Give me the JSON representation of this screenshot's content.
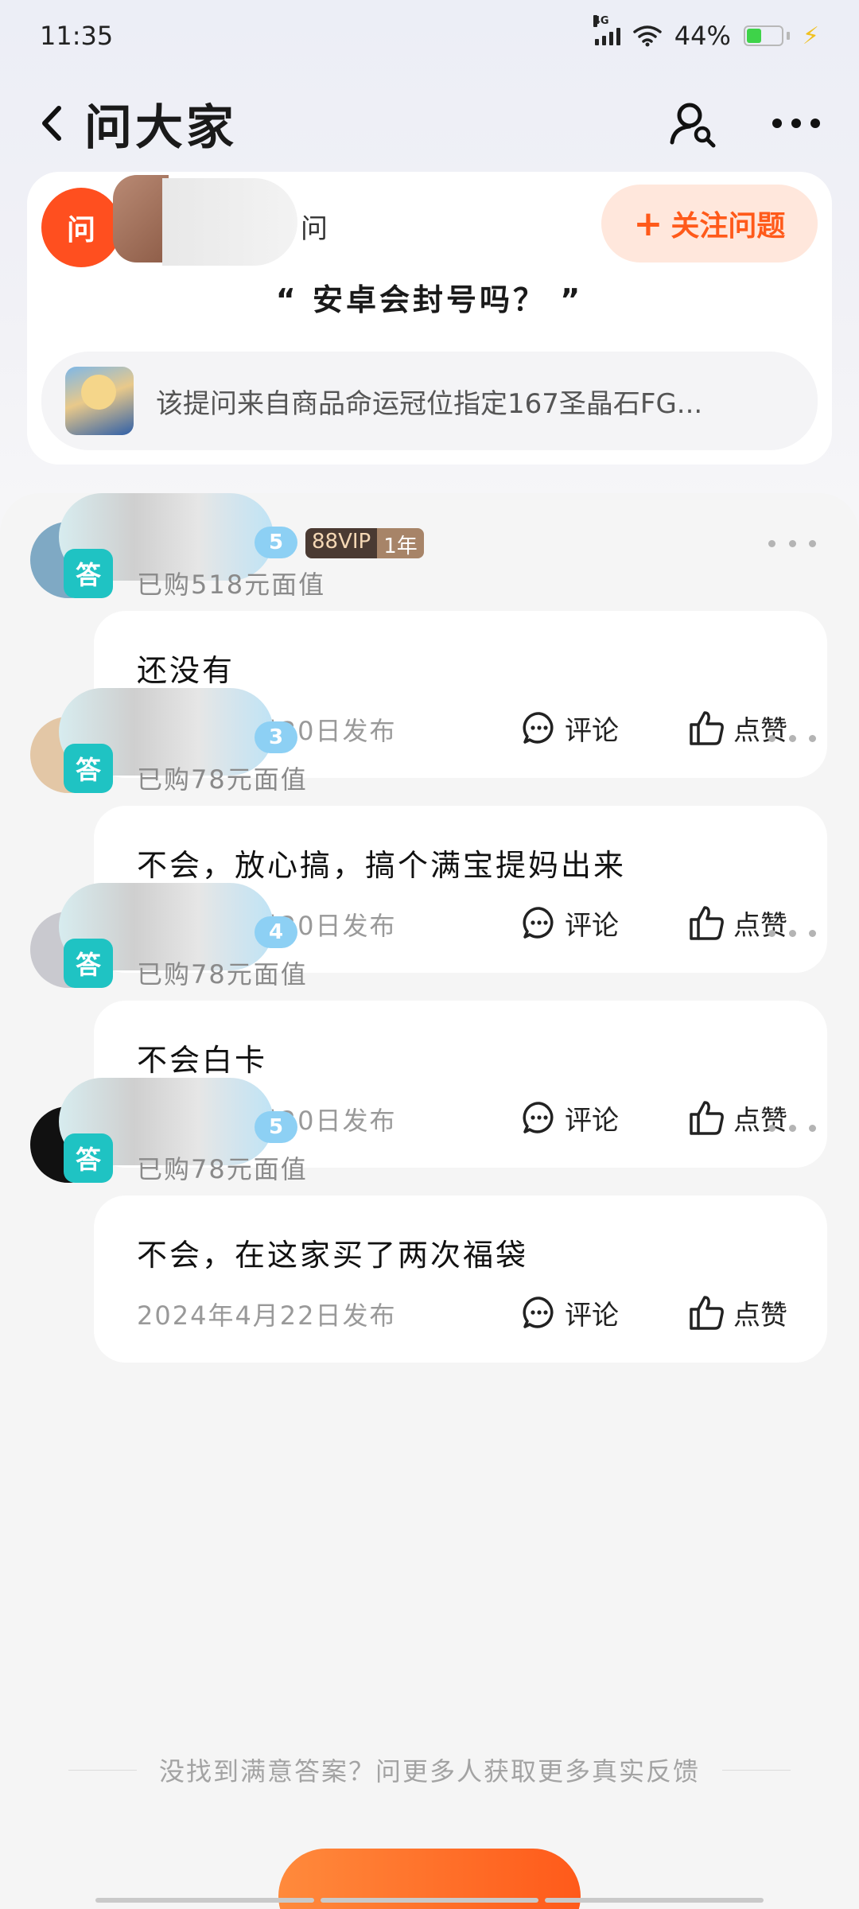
{
  "status_bar": {
    "time": "11:35",
    "network": "4G",
    "battery_percent": "44%",
    "battery_level": 0.44
  },
  "nav": {
    "title": "问大家"
  },
  "question": {
    "badge": "问",
    "asker_suffix": "问",
    "follow_label": "关注问题",
    "text": "“ 安卓会封号吗？ ”",
    "source": "该提问来自商品命运冠位指定167圣晶石FG..."
  },
  "answers": [
    {
      "tag": "答",
      "level": "5",
      "vip": "88VIP",
      "vip_years": "1年",
      "purchase": "已购518元面值",
      "text": "还没有",
      "date": "2024年6月30日发布",
      "comment_label": "评论",
      "like_label": "点赞",
      "avatar_color": "#7fa9c4"
    },
    {
      "tag": "答",
      "level": "3",
      "purchase": "已购78元面值",
      "text": "不会，放心搞，搞个满宝提妈出来",
      "date": "2024年4月20日发布",
      "comment_label": "评论",
      "like_label": "点赞",
      "avatar_color": "#e3c7a6"
    },
    {
      "tag": "答",
      "level": "4",
      "purchase": "已购78元面值",
      "text": "不会白卡",
      "date": "2024年4月20日发布",
      "comment_label": "评论",
      "like_label": "点赞",
      "avatar_color": "#c9c9cf"
    },
    {
      "tag": "答",
      "level": "5",
      "purchase": "已购78元面值",
      "text": "不会，在这家买了两次福袋",
      "date": "2024年4月22日发布",
      "comment_label": "评论",
      "like_label": "点赞",
      "avatar_color": "#111111"
    }
  ],
  "footer": {
    "note": "没找到满意答案？问更多人获取更多真实反馈"
  },
  "colors": {
    "accent": "#ff5a1a",
    "answer_tag": "#1fc3c3"
  }
}
